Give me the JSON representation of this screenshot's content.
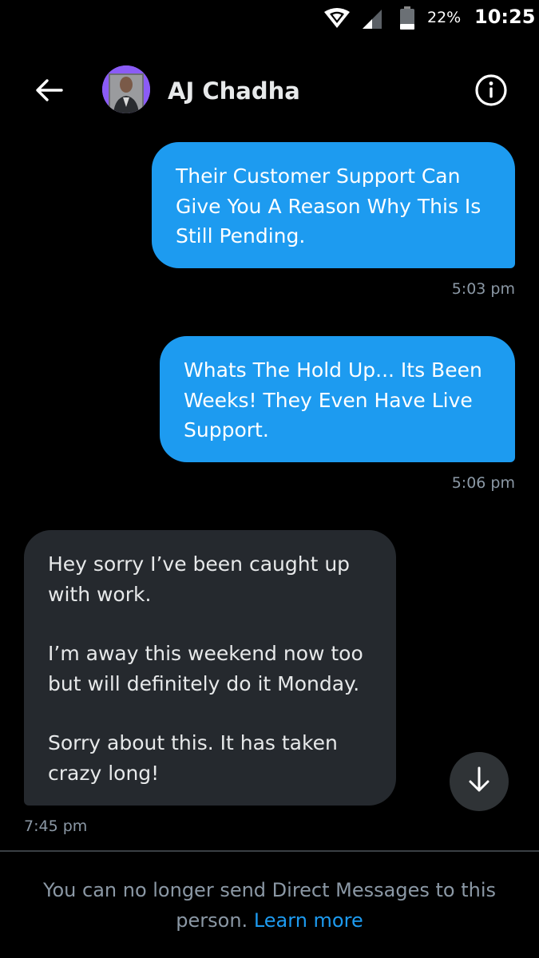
{
  "status_bar": {
    "battery_percent": "22%",
    "time": "10:25",
    "icons": [
      "wifi-icon",
      "cell-signal-icon",
      "battery-icon"
    ]
  },
  "header": {
    "contact_name": "AJ Chadha",
    "back_icon": "arrow-left-icon",
    "info_icon": "info-circle-icon"
  },
  "messages": [
    {
      "direction": "outgoing",
      "paragraphs": [
        "Their Customer Support Can\nGive You A Reason Why This Is\nStill Pending."
      ],
      "time": "5:03 pm"
    },
    {
      "direction": "outgoing",
      "paragraphs": [
        "Whats The Hold Up... Its Been\nWeeks! They Even Have Live\nSupport."
      ],
      "time": "5:06 pm"
    },
    {
      "direction": "incoming",
      "paragraphs": [
        "Hey sorry I’ve been caught up\nwith work.",
        "I’m away this weekend now too\nbut will definitely do it Monday.",
        "Sorry about this. It has taken\ncrazy long!"
      ],
      "time": "7:45 pm"
    }
  ],
  "scroll_button_icon": "arrow-down-icon",
  "footer": {
    "notice": "You can no longer send Direct Messages to this person.",
    "link_text": "Learn more"
  },
  "colors": {
    "background": "#000000",
    "outgoing_bubble": "#1d9bf0",
    "incoming_bubble": "#25292e",
    "link": "#1d9bf0",
    "muted_text": "#8b98a5"
  }
}
